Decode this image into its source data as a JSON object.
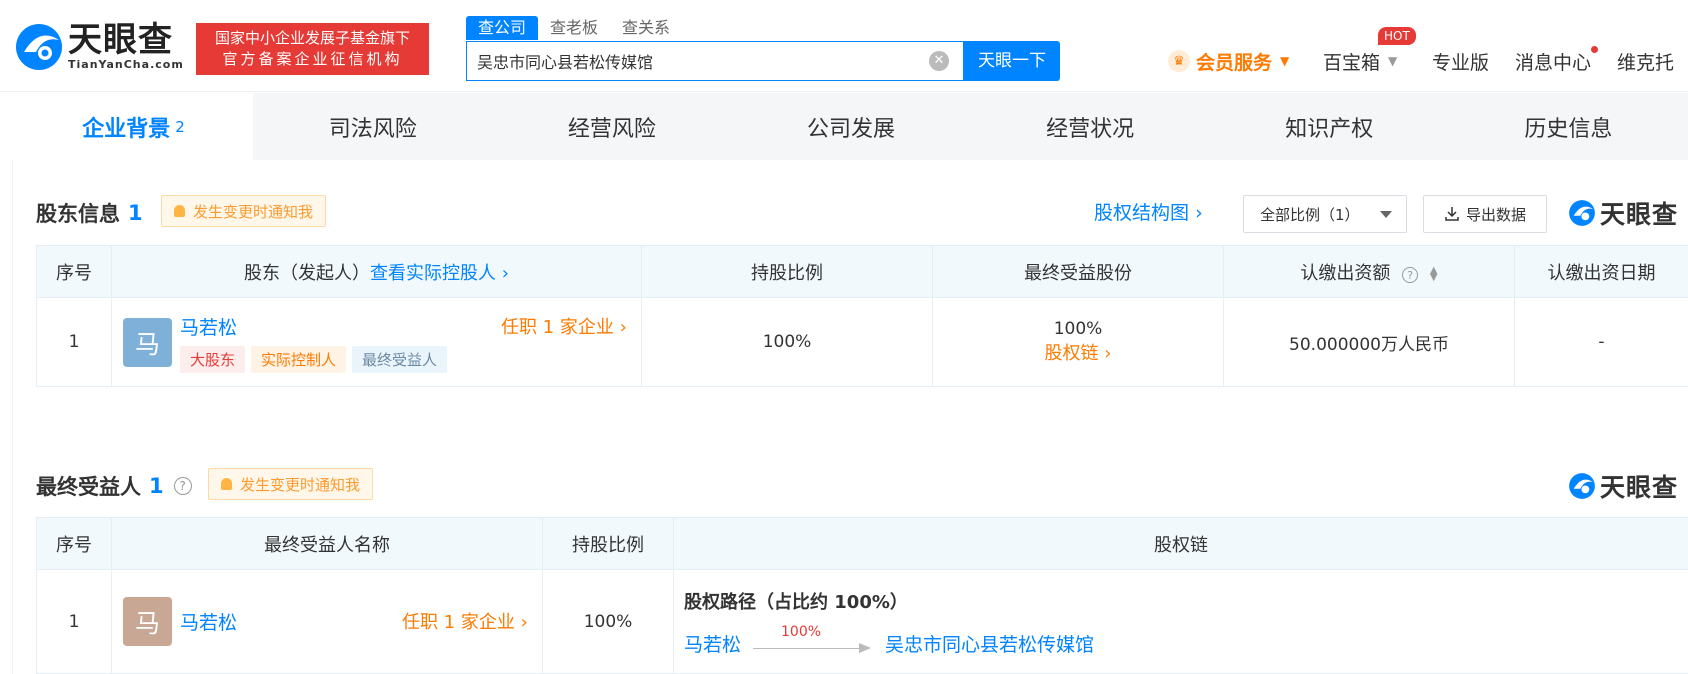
{
  "header": {
    "logo_cn": "天眼查",
    "logo_en": "TianYanCha.com",
    "promo_line1": "国家中小企业发展子基金旗下",
    "promo_line2": "官方备案企业征信机构",
    "search_tabs": [
      "查公司",
      "查老板",
      "查关系"
    ],
    "search_value": "吴忠市同心县若松传媒馆",
    "search_button": "天眼一下",
    "nav": {
      "vip": "会员服务",
      "tools": "百宝箱",
      "hot_badge": "HOT",
      "pro": "专业版",
      "messages": "消息中心",
      "user": "维克托"
    }
  },
  "tabs": [
    {
      "label": "企业背景",
      "count": "2"
    },
    {
      "label": "司法风险",
      "count": ""
    },
    {
      "label": "经营风险",
      "count": ""
    },
    {
      "label": "公司发展",
      "count": ""
    },
    {
      "label": "经营状况",
      "count": ""
    },
    {
      "label": "知识产权",
      "count": ""
    },
    {
      "label": "历史信息",
      "count": ""
    }
  ],
  "shareholders": {
    "title": "股东信息",
    "count": "1",
    "notify": "发生变更时通知我",
    "structure_link": "股权结构图",
    "filter": "全部比例（1）",
    "export": "导出数据",
    "watermark": "天眼查",
    "columns": {
      "seq": "序号",
      "holder": "股东（发起人）",
      "holder_link": "查看实际控股人",
      "ratio": "持股比例",
      "benefit": "最终受益股份",
      "capital": "认缴出资额",
      "date": "认缴出资日期"
    },
    "rows": [
      {
        "seq": "1",
        "avatar": "马",
        "name": "马若松",
        "job": "任职 1 家企业",
        "tags": [
          "大股东",
          "实际控制人",
          "最终受益人"
        ],
        "ratio": "100%",
        "benefit": "100%",
        "benefit_link": "股权链",
        "capital": "50.000000万人民币",
        "date": "-"
      }
    ]
  },
  "beneficiaries": {
    "title": "最终受益人",
    "count": "1",
    "notify": "发生变更时通知我",
    "watermark": "天眼查",
    "columns": {
      "seq": "序号",
      "name": "最终受益人名称",
      "ratio": "持股比例",
      "chain": "股权链"
    },
    "rows": [
      {
        "seq": "1",
        "avatar": "马",
        "name": "马若松",
        "job": "任职 1 家企业",
        "ratio": "100%",
        "path_title": "股权路径（占比约 100%）",
        "path_from": "马若松",
        "path_pct": "100%",
        "path_to": "吴忠市同心县若松传媒馆"
      }
    ]
  },
  "colors": {
    "brand": "#0084ff",
    "accent_orange": "#ff7a00",
    "alert_red": "#e63a36",
    "avatar_blue": "#7fb0d8",
    "avatar_brown": "#c9a795"
  }
}
